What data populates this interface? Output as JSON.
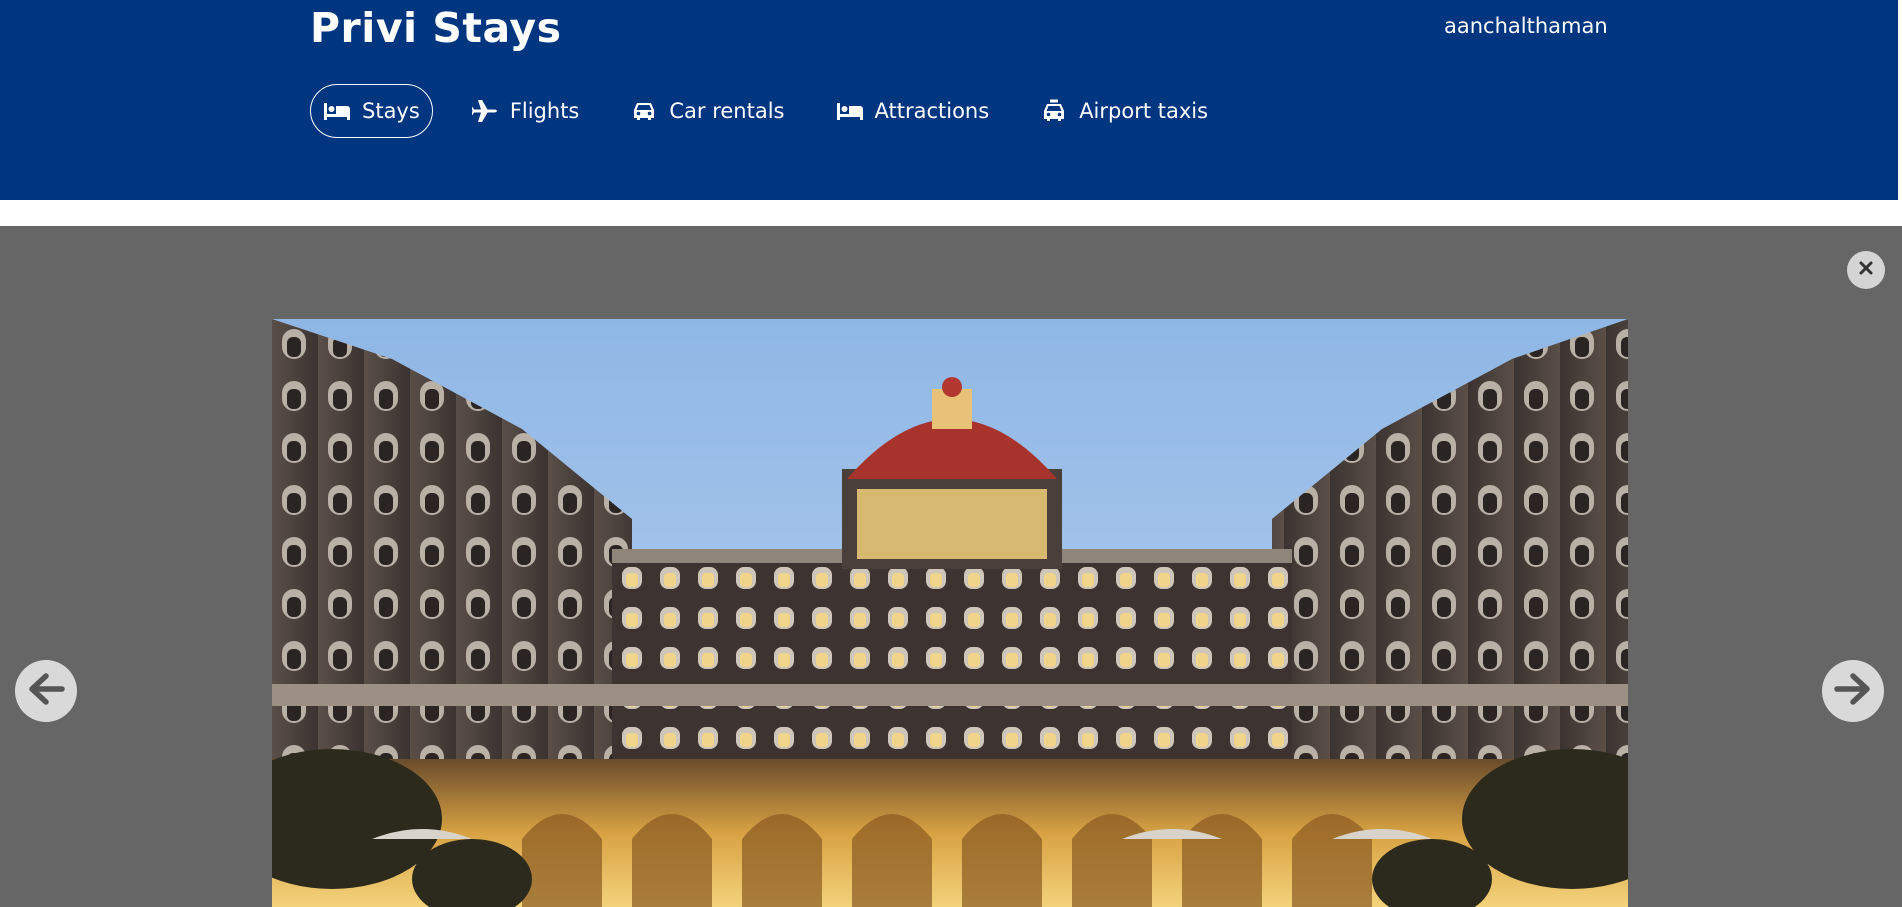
{
  "header": {
    "brand": "Privi Stays",
    "username": "aanchalthaman",
    "background_color": "#003580"
  },
  "nav": {
    "items": [
      {
        "label": "Stays",
        "icon": "bed-icon",
        "active": true
      },
      {
        "label": "Flights",
        "icon": "plane-icon",
        "active": false
      },
      {
        "label": "Car rentals",
        "icon": "car-icon",
        "active": false
      },
      {
        "label": "Attractions",
        "icon": "bed-icon",
        "active": false
      },
      {
        "label": "Airport taxis",
        "icon": "taxi-icon",
        "active": false
      }
    ]
  },
  "gallery": {
    "overlay_color": "#666666",
    "close_icon": "close-icon",
    "prev_icon": "arrow-left-icon",
    "next_icon": "arrow-right-icon",
    "photo_subject": "hotel-building-photo"
  }
}
